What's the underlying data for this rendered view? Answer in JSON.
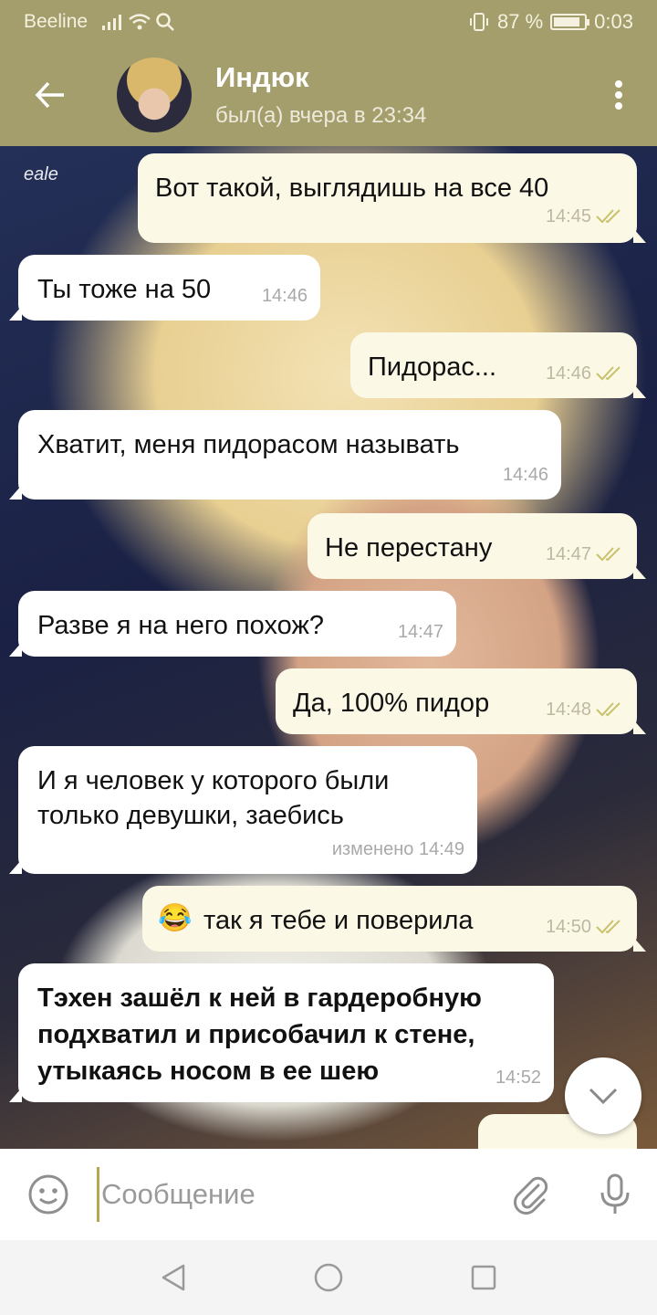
{
  "status_bar": {
    "carrier": "Beeline",
    "battery_text": "87 %",
    "battery_level": 0.87,
    "time": "0:03"
  },
  "header": {
    "contact_name": "Индюк",
    "last_seen": "был(а) вчера в 23:34"
  },
  "chat": {
    "watermark": "eale",
    "messages": [
      {
        "direction": "out",
        "text": "Вот такой, выглядишь на все 40",
        "time": "14:45",
        "read": true
      },
      {
        "direction": "in",
        "text": "Ты тоже на 50",
        "time": "14:46"
      },
      {
        "direction": "out",
        "text": "Пидорас...",
        "time": "14:46",
        "read": true
      },
      {
        "direction": "in",
        "text": "Хватит, меня пидорасом называть",
        "time": "14:46"
      },
      {
        "direction": "out",
        "text": "Не перестану",
        "time": "14:47",
        "read": true
      },
      {
        "direction": "in",
        "text": "Разве я на него похож?",
        "time": "14:47"
      },
      {
        "direction": "out",
        "text": "Да, 100% пидор",
        "time": "14:48",
        "read": true
      },
      {
        "direction": "in",
        "lines": [
          "И я человек у которого были",
          "только девушки, заебись"
        ],
        "time": "изменено 14:49"
      },
      {
        "direction": "out",
        "emoji": "😂",
        "text": "так я тебе и поверила",
        "time": "14:50",
        "read": true
      },
      {
        "direction": "in",
        "lines": [
          "Тэхен зашёл к ней в гардеробную",
          "подхватил и присобачил к стене,",
          "утыкаясь носом в ее шею"
        ],
        "time": "14:52",
        "bold": true
      }
    ]
  },
  "input": {
    "placeholder": "Сообщение"
  },
  "colors": {
    "header": "#a39e6b",
    "outgoing_bubble": "#fcf8e6",
    "incoming_bubble": "#ffffff",
    "read_check": "#c9c16c"
  }
}
